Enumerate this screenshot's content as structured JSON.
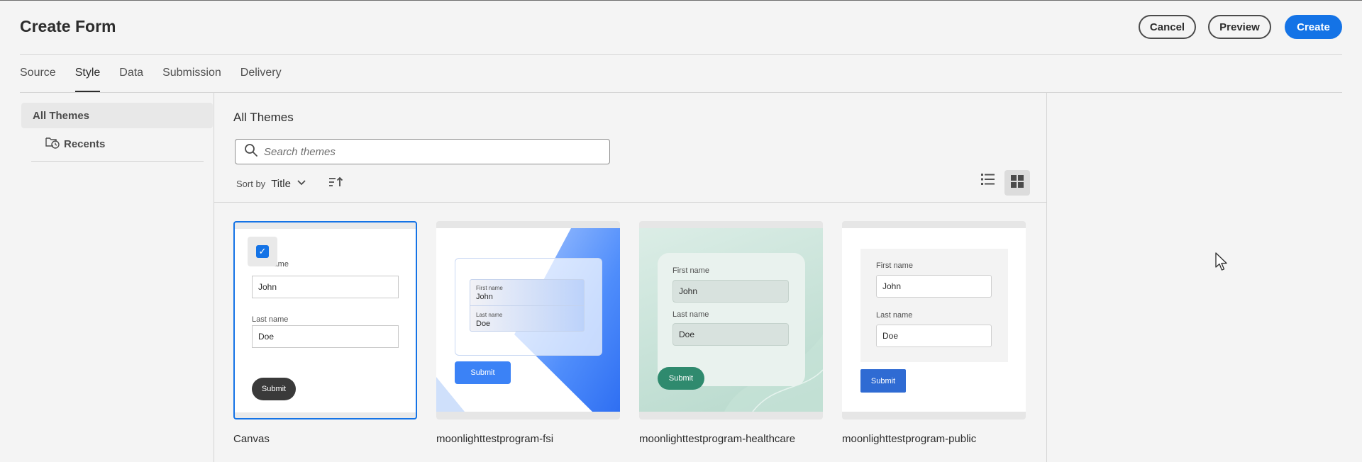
{
  "header": {
    "title": "Create Form",
    "cancel_label": "Cancel",
    "preview_label": "Preview",
    "create_label": "Create"
  },
  "tabs": [
    {
      "label": "Source",
      "active": false
    },
    {
      "label": "Style",
      "active": true
    },
    {
      "label": "Data",
      "active": false
    },
    {
      "label": "Submission",
      "active": false
    },
    {
      "label": "Delivery",
      "active": false
    }
  ],
  "sidebar": {
    "items": [
      {
        "label": "All Themes",
        "icon": null,
        "selected": true
      },
      {
        "label": "Recents",
        "icon": "folder-clock-icon",
        "selected": false
      }
    ]
  },
  "main": {
    "title": "All Themes",
    "search": {
      "placeholder": "Search themes",
      "value": ""
    },
    "sort": {
      "label": "Sort by",
      "value": "Title",
      "direction": "ascending"
    },
    "view_mode": "grid"
  },
  "themes": [
    {
      "name": "Canvas",
      "selected": true,
      "preview": {
        "first_label": "First name",
        "first_value": "John",
        "last_label": "Last name",
        "last_value": "Doe",
        "submit": "Submit",
        "accent": "#3a3a3a"
      }
    },
    {
      "name": "moonlighttestprogram-fsi",
      "selected": false,
      "preview": {
        "first_label": "First name",
        "first_value": "John",
        "last_label": "Last name",
        "last_value": "Doe",
        "submit": "Submit",
        "accent": "#3b82f6"
      }
    },
    {
      "name": "moonlighttestprogram-healthcare",
      "selected": false,
      "preview": {
        "first_label": "First name",
        "first_value": "John",
        "last_label": "Last name",
        "last_value": "Doe",
        "submit": "Submit",
        "accent": "#2f8a6e"
      }
    },
    {
      "name": "moonlighttestprogram-public",
      "selected": false,
      "preview": {
        "first_label": "First name",
        "first_value": "John",
        "last_label": "Last name",
        "last_value": "Doe",
        "submit": "Submit",
        "accent": "#2f6bd3"
      }
    }
  ],
  "colors": {
    "primary": "#1473e6",
    "background": "#f4f4f4"
  }
}
